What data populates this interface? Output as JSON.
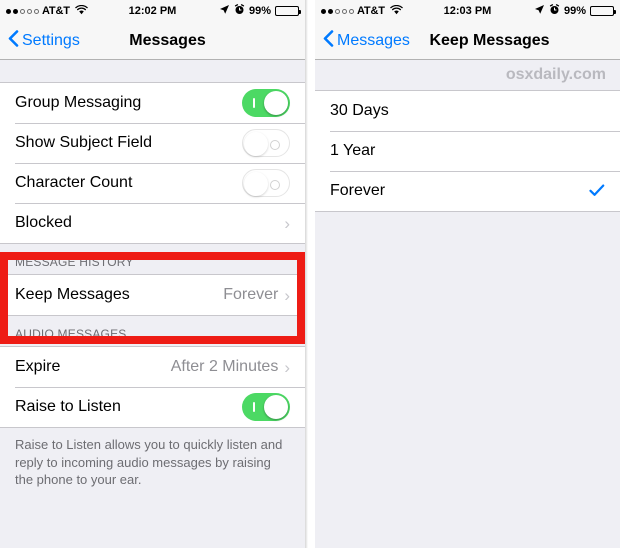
{
  "colors": {
    "accent_blue": "#007aff",
    "toggle_green": "#4cd964",
    "annotation_red": "#ee1c15",
    "group_bg": "#efeff4",
    "value_gray": "#8e8e93"
  },
  "left": {
    "statusbar": {
      "carrier": "AT&T",
      "signal_filled": 2,
      "signal_empty": 3,
      "wifi_icon": "wifi-icon",
      "time": "12:02 PM",
      "location_icon": "location-arrow-icon",
      "alarm_icon": "alarm-clock-icon",
      "battery_percent": "99%",
      "battery_level": 100
    },
    "nav": {
      "back_label": "Settings",
      "back_icon": "chevron-left-icon",
      "title": "Messages"
    },
    "group1": [
      {
        "label": "Group Messaging",
        "type": "toggle",
        "value": "on"
      },
      {
        "label": "Show Subject Field",
        "type": "toggle",
        "value": "off"
      },
      {
        "label": "Character Count",
        "type": "toggle",
        "value": "off"
      },
      {
        "label": "Blocked",
        "type": "disclosure",
        "value": ""
      }
    ],
    "message_history": {
      "header": "MESSAGE HISTORY",
      "rows": [
        {
          "label": "Keep Messages",
          "type": "disclosure",
          "value": "Forever"
        }
      ]
    },
    "audio_messages": {
      "header": "AUDIO MESSAGES",
      "rows": [
        {
          "label": "Expire",
          "type": "disclosure",
          "value": "After 2 Minutes"
        },
        {
          "label": "Raise to Listen",
          "type": "toggle",
          "value": "on"
        }
      ]
    },
    "footnote": "Raise to Listen allows you to quickly listen and reply to incoming audio messages by raising the phone to your ear."
  },
  "right": {
    "statusbar": {
      "carrier": "AT&T",
      "signal_filled": 2,
      "signal_empty": 3,
      "wifi_icon": "wifi-icon",
      "time": "12:03 PM",
      "location_icon": "location-arrow-icon",
      "alarm_icon": "alarm-clock-icon",
      "battery_percent": "99%",
      "battery_level": 100
    },
    "nav": {
      "back_label": "Messages",
      "back_icon": "chevron-left-icon",
      "title": "Keep Messages"
    },
    "watermark": "osxdaily.com",
    "options": [
      {
        "label": "30 Days",
        "selected": false
      },
      {
        "label": "1 Year",
        "selected": false
      },
      {
        "label": "Forever",
        "selected": true
      }
    ],
    "check_icon": "checkmark-icon"
  }
}
